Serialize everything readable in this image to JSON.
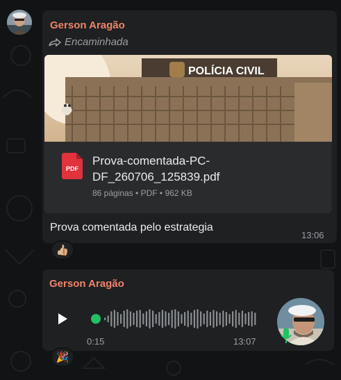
{
  "colors": {
    "background": "#121314",
    "bubble": "#1f2021",
    "sender": "#f0846a",
    "meta_text": "#9aa0a4",
    "pdf_red": "#e0333c",
    "voice_green": "#21c063"
  },
  "message1": {
    "sender": "Gerson Aragão",
    "forwarded_label": "Encaminhada",
    "thumbnail_text": "POLÍCIA CIVIL",
    "document": {
      "icon": "pdf-icon",
      "icon_label": "PDF",
      "file_name": "Prova-comentada-PC-DF_260706_125839.pdf",
      "meta": "86 páginas • PDF • 962 KB"
    },
    "caption": "Prova comentada pelo estrategia",
    "time": "13:06",
    "reaction": "👍🏼"
  },
  "message2": {
    "sender": "Gerson Aragão",
    "voice": {
      "duration": "0:15",
      "progress": 0.0,
      "time": "13:07"
    },
    "reaction": "🎉"
  }
}
